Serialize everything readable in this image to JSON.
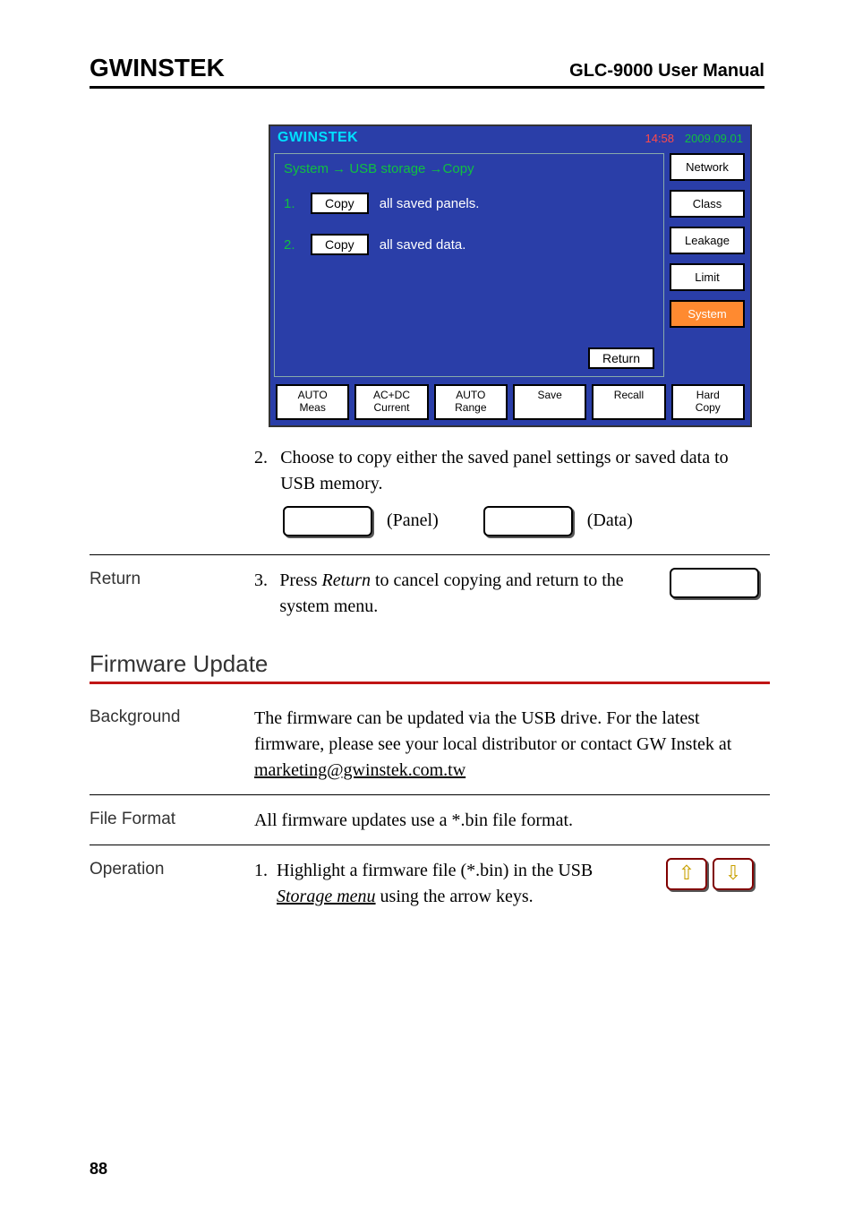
{
  "header": {
    "logo": "GWINSTEK",
    "manual": "GLC-9000 User Manual"
  },
  "device": {
    "logo": "GWINSTEK",
    "time": "14:58",
    "date": "2009.09.01",
    "breadcrumb": "System → USB storage →Copy",
    "rows": [
      {
        "num": "1.",
        "btn": "Copy",
        "text": "all saved panels."
      },
      {
        "num": "2.",
        "btn": "Copy",
        "text": "all saved data."
      }
    ],
    "return": "Return",
    "side": [
      {
        "label": "Network",
        "active": false
      },
      {
        "label": "Class",
        "active": false
      },
      {
        "label": "Leakage",
        "active": false
      },
      {
        "label": "Limit",
        "active": false
      },
      {
        "label": "System",
        "active": true
      }
    ],
    "bottom": [
      "AUTO\nMeas",
      "AC+DC\nCurrent",
      "AUTO\nRange",
      "Save",
      "Recall",
      "Hard\nCopy"
    ]
  },
  "step2": {
    "num": "2.",
    "text": "Choose to copy either the saved panel settings or saved data to USB memory.",
    "panel_label": "(Panel)",
    "data_label": "(Data)"
  },
  "return_row": {
    "label": "Return",
    "num": "3.",
    "text_a": "Press ",
    "text_i": "Return",
    "text_b": " to cancel copying and return to the system menu."
  },
  "firmware": {
    "title": "Firmware Update",
    "bg_label": "Background",
    "bg_text_a": "The firmware can be updated via the USB drive. For the latest firmware, please see your local distributor or contact GW Instek at ",
    "bg_email": "marketing@gwinstek.com.tw",
    "ff_label": "File Format",
    "ff_text": "All firmware updates use a *.bin file format.",
    "op_label": "Operation",
    "op_num": "1.",
    "op_text_a": "Highlight a firmware file (*.bin) in the USB ",
    "op_link": "Storage menu",
    "op_text_b": " using the arrow keys.",
    "arrow_up": "⇧",
    "arrow_down": "⇩"
  },
  "page": "88"
}
